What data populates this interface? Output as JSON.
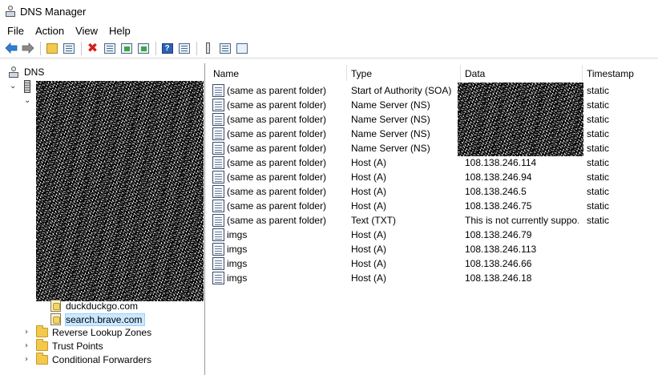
{
  "window": {
    "title": "DNS Manager",
    "app_icon": "dns-manager-icon"
  },
  "menu": {
    "file": "File",
    "action": "Action",
    "view": "View",
    "help": "Help"
  },
  "toolbar": {
    "buttons": [
      "back-arrow-icon",
      "forward-arrow-icon",
      "up-folder-icon",
      "show-hide-tree-icon",
      "delete-icon",
      "properties-icon",
      "refresh-icon",
      "export-list-icon",
      "help-icon",
      "mmc-icon",
      "server-icon",
      "new-record-icon",
      "filter-icon"
    ]
  },
  "tree": {
    "root": "DNS",
    "zones": [
      {
        "name": "duckduckgo.com",
        "selected": false
      },
      {
        "name": "search.brave.com",
        "selected": true
      }
    ],
    "reverse_lookup": "Reverse Lookup Zones",
    "trust_points": "Trust Points",
    "conditional_forwarders": "Conditional Forwarders"
  },
  "table": {
    "columns": [
      "Name",
      "Type",
      "Data",
      "Timestamp"
    ],
    "rows": [
      [
        "(same as parent folder)",
        "Start of Authority (SOA)",
        "",
        "static"
      ],
      [
        "(same as parent folder)",
        "Name Server (NS)",
        "",
        "static"
      ],
      [
        "(same as parent folder)",
        "Name Server (NS)",
        "",
        "static"
      ],
      [
        "(same as parent folder)",
        "Name Server (NS)",
        "",
        "static"
      ],
      [
        "(same as parent folder)",
        "Name Server (NS)",
        "",
        "static"
      ],
      [
        "(same as parent folder)",
        "Host (A)",
        "108.138.246.114",
        "static"
      ],
      [
        "(same as parent folder)",
        "Host (A)",
        "108.138.246.94",
        "static"
      ],
      [
        "(same as parent folder)",
        "Host (A)",
        "108.138.246.5",
        "static"
      ],
      [
        "(same as parent folder)",
        "Host (A)",
        "108.138.246.75",
        "static"
      ],
      [
        "(same as parent folder)",
        "Text (TXT)",
        "This is not currently suppo...",
        "static"
      ],
      [
        "imgs",
        "Host (A)",
        "108.138.246.79",
        ""
      ],
      [
        "imgs",
        "Host (A)",
        "108.138.246.113",
        ""
      ],
      [
        "imgs",
        "Host (A)",
        "108.138.246.66",
        ""
      ],
      [
        "imgs",
        "Host (A)",
        "108.138.246.18",
        ""
      ]
    ]
  },
  "colors": {
    "selection": "#cce8ff",
    "selection_border": "#99d1ff",
    "folder": "#f2c94c"
  }
}
